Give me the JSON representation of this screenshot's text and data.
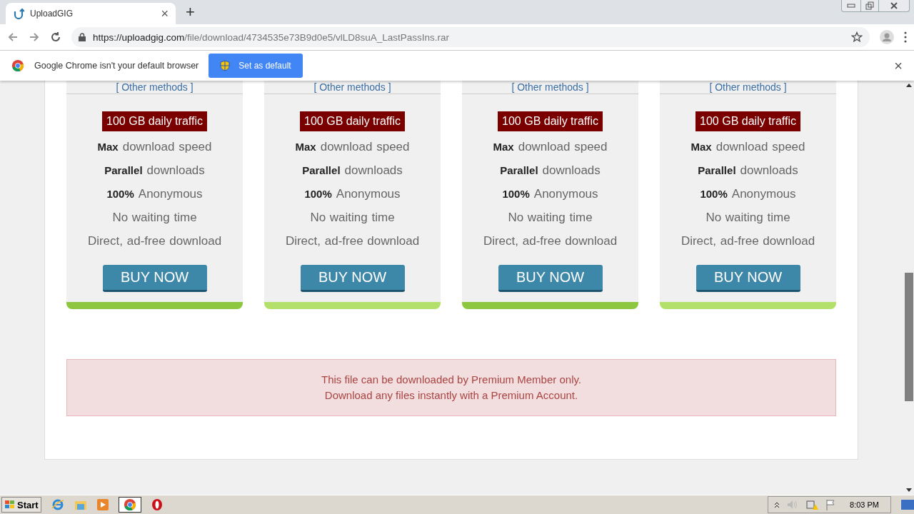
{
  "browser": {
    "tab": {
      "title": "UploadGIG",
      "close": "×"
    },
    "new_tab": "+",
    "url_host": "https://uploadgig.com",
    "url_path": "/file/download/4734535e73B9d0e5/vlLD8suA_LastPassIns.rar"
  },
  "infobar": {
    "message": "Google Chrome isn't your default browser",
    "button": "Set as default",
    "close": "×"
  },
  "plans": [
    {
      "other": "[ Other methods ]",
      "traffic": "100 GB daily traffic",
      "color": "#8dc63f",
      "features": [
        {
          "bold": "Max",
          "text": "download speed"
        },
        {
          "bold": "Parallel",
          "text": "downloads"
        },
        {
          "bold": "100%",
          "text": "Anonymous"
        },
        {
          "text": "No waiting time"
        },
        {
          "text": "Direct, ad-free download"
        }
      ],
      "button": "BUY NOW"
    },
    {
      "other": "[ Other methods ]",
      "traffic": "100 GB daily traffic",
      "color": "#b3e06a",
      "features": [
        {
          "bold": "Max",
          "text": "download speed"
        },
        {
          "bold": "Parallel",
          "text": "downloads"
        },
        {
          "bold": "100%",
          "text": "Anonymous"
        },
        {
          "text": "No waiting time"
        },
        {
          "text": "Direct, ad-free download"
        }
      ],
      "button": "BUY NOW"
    },
    {
      "other": "[ Other methods ]",
      "traffic": "100 GB daily traffic",
      "color": "#8dc63f",
      "features": [
        {
          "bold": "Max",
          "text": "download speed"
        },
        {
          "bold": "Parallel",
          "text": "downloads"
        },
        {
          "bold": "100%",
          "text": "Anonymous"
        },
        {
          "text": "No waiting time"
        },
        {
          "text": "Direct, ad-free download"
        }
      ],
      "button": "BUY NOW"
    },
    {
      "other": "[ Other methods ]",
      "traffic": "100 GB daily traffic",
      "color": "#b3e06a",
      "features": [
        {
          "bold": "Max",
          "text": "download speed"
        },
        {
          "bold": "Parallel",
          "text": "downloads"
        },
        {
          "bold": "100%",
          "text": "Anonymous"
        },
        {
          "text": "No waiting time"
        },
        {
          "text": "Direct, ad-free download"
        }
      ],
      "button": "BUY NOW"
    }
  ],
  "alert": [
    "This file can be downloaded by Premium Member only.",
    "Download any files instantly with a Premium Account."
  ],
  "taskbar": {
    "start": "Start",
    "clock": "8:03 PM"
  }
}
